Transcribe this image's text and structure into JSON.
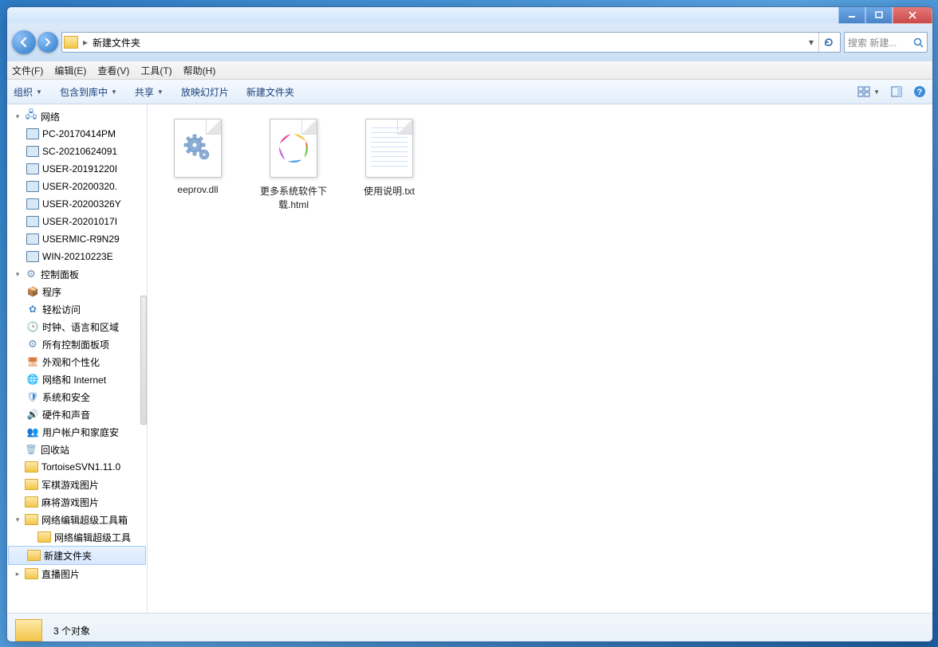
{
  "breadcrumb": {
    "current": "新建文件夹"
  },
  "search": {
    "placeholder": "搜索 新建..."
  },
  "menubar": {
    "file": "文件(F)",
    "edit": "编辑(E)",
    "view": "查看(V)",
    "tools": "工具(T)",
    "help": "帮助(H)"
  },
  "toolbar": {
    "organize": "组织",
    "include_lib": "包含到库中",
    "share": "共享",
    "slideshow": "放映幻灯片",
    "new_folder": "新建文件夹"
  },
  "sidebar": {
    "network": "网络",
    "computers": [
      "PC-20170414PM",
      "SC-20210624091",
      "USER-20191220I",
      "USER-20200320.",
      "USER-20200326Y",
      "USER-20201017I",
      "USERMIC-R9N29",
      "WIN-20210223E"
    ],
    "control_panel": "控制面板",
    "cpl_items": [
      "程序",
      "轻松访问",
      "时钟、语言和区域",
      "所有控制面板项",
      "外观和个性化",
      "网络和 Internet",
      "系统和安全",
      "硬件和声音",
      "用户帐户和家庭安"
    ],
    "recycle": "回收站",
    "folders": [
      "TortoiseSVN1.11.0",
      "军棋游戏图片",
      "麻将游戏图片",
      "网络编辑超级工具箱"
    ],
    "sub_folder": "网络编辑超级工具",
    "selected_folder": "新建文件夹",
    "last_folder": "直播图片"
  },
  "files": [
    {
      "name": "eeprov.dll",
      "type": "dll"
    },
    {
      "name": "更多系统软件下载.html",
      "type": "html"
    },
    {
      "name": "使用说明.txt",
      "type": "txt"
    }
  ],
  "status": {
    "count": "3 个对象"
  }
}
